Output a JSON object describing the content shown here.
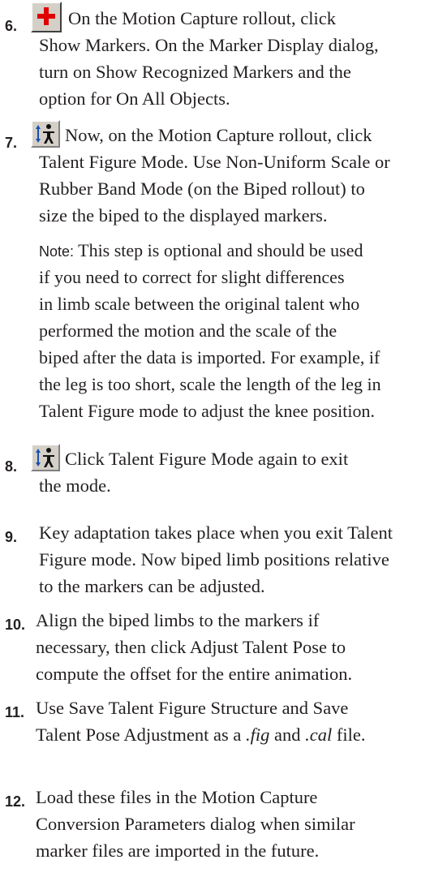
{
  "steps": [
    {
      "num": "6.",
      "icon": "show-markers-icon",
      "lines": [
        "On the Motion Capture rollout, click",
        "Show Markers. On the Marker Display dialog,",
        "turn on Show Recognized Markers and the",
        "option for On All Objects."
      ]
    },
    {
      "num": "7.",
      "icon": "talent-figure-mode-icon",
      "lines": [
        "Now, on the Motion Capture rollout, click",
        "Talent Figure Mode. Use Non-Uniform Scale or",
        "Rubber Band Mode (on the Biped rollout) to",
        "size the biped to the displayed markers."
      ]
    },
    {
      "num": "8.",
      "icon": "talent-figure-mode-icon",
      "lines": [
        "Click Talent Figure Mode again to exit",
        "the mode."
      ]
    },
    {
      "num": "9.",
      "lines": [
        "Key adaptation takes place when you exit Talent",
        "Figure mode. Now biped limb positions relative",
        "to the markers can be adjusted."
      ]
    },
    {
      "num": "10.",
      "lines": [
        "Align the biped limbs to the markers if",
        "necessary, then click Adjust Talent Pose to",
        "compute the offset for the entire animation."
      ]
    },
    {
      "num": "11.",
      "line1": "Use Save Talent Figure Structure and Save",
      "line2_a": "Talent Pose Adjustment as a ",
      "line2_b": ".fig",
      "line2_c": " and ",
      "line2_d": ".cal",
      "line2_e": " file."
    },
    {
      "num": "12.",
      "lines": [
        "Load these files in the Motion Capture",
        "Conversion Parameters dialog when similar",
        "marker files are imported in the future."
      ]
    }
  ],
  "note": {
    "label": "Note:",
    "lines": [
      " This step is optional and should be used",
      "if you need to correct for slight differences",
      "in limb scale between the original talent who",
      "performed the motion and the scale of the",
      "biped after the data is imported. For example, if",
      "the leg is too short, scale the length of the leg in",
      "Talent Figure mode to adjust the knee position."
    ]
  }
}
